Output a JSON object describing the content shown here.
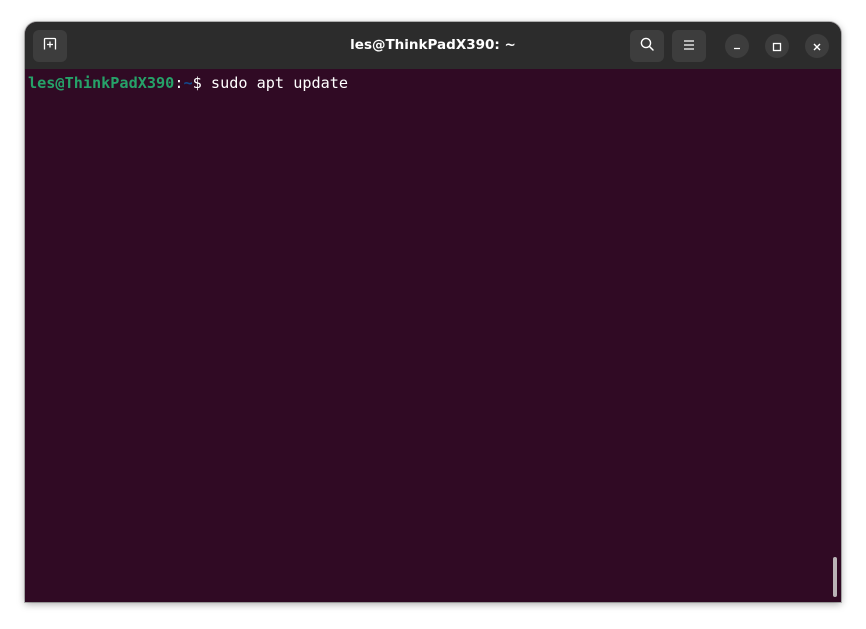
{
  "window": {
    "title": "les@ThinkPadX390: ~"
  },
  "titlebar": {
    "new_tab_icon": "new-tab-icon",
    "search_icon": "search-icon",
    "menu_icon": "hamburger-menu-icon",
    "minimize_icon": "minimize-icon",
    "maximize_icon": "maximize-icon",
    "close_icon": "close-icon"
  },
  "terminal": {
    "prompt_user_host": "les@ThinkPadX390",
    "prompt_colon": ":",
    "prompt_path": "~",
    "prompt_symbol": "$ ",
    "command": "sudo apt update"
  },
  "colors": {
    "terminal_bg": "#300a24",
    "titlebar_bg": "#2c2c2c",
    "prompt_user": "#26a269",
    "prompt_path": "#12488b",
    "text": "#ffffff"
  }
}
